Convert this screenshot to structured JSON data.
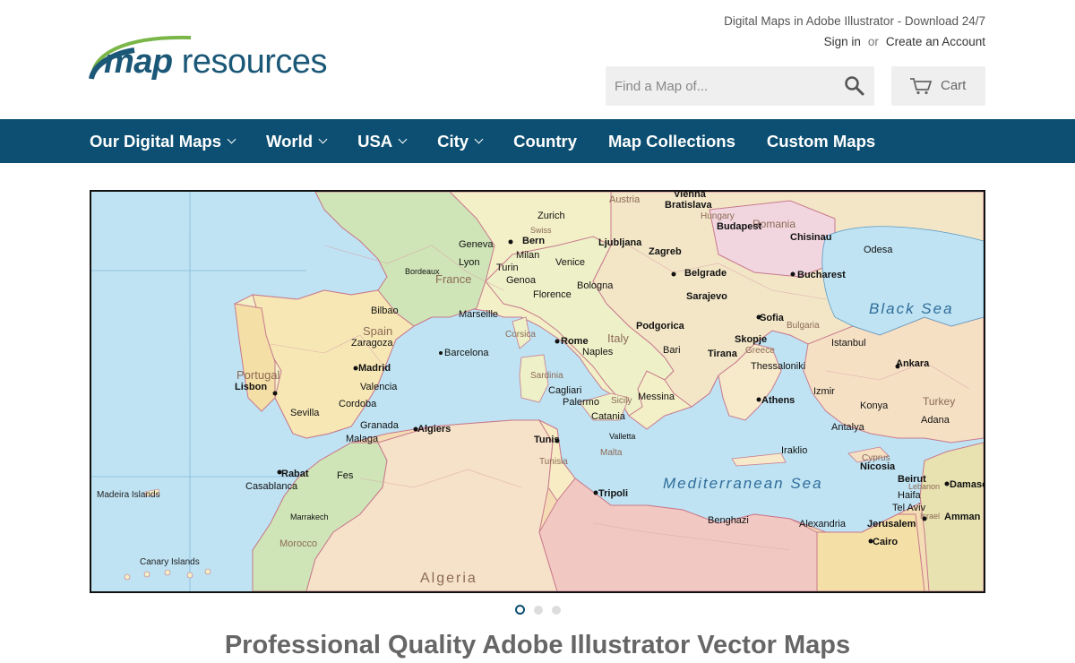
{
  "brand": {
    "logo_bold": "map",
    "logo_light": "resources"
  },
  "header": {
    "tagline": "Digital Maps in Adobe Illustrator - Download 24/7",
    "sign_in": "Sign in",
    "or": "or",
    "create_account": "Create an Account",
    "search_placeholder": "Find a Map of...",
    "cart_label": "Cart"
  },
  "nav": {
    "items": [
      {
        "label": "Our Digital Maps",
        "dropdown": true
      },
      {
        "label": "World",
        "dropdown": true
      },
      {
        "label": "USA",
        "dropdown": true
      },
      {
        "label": "City",
        "dropdown": true
      },
      {
        "label": "Country",
        "dropdown": false
      },
      {
        "label": "Map Collections",
        "dropdown": false
      },
      {
        "label": "Custom Maps",
        "dropdown": false
      }
    ]
  },
  "hero_map": {
    "seas": [
      "Black Sea",
      "Mediterranean Sea"
    ],
    "countries": [
      "France",
      "Spain",
      "Portugal",
      "Italy",
      "Sardinia",
      "Corsica",
      "Sicily",
      "Tunisia",
      "Algeria",
      "Morocco",
      "Romania",
      "Bulgaria",
      "Greece",
      "Turkey",
      "Malta",
      "Hungary",
      "Cyprus",
      "Lebanon",
      "Israel",
      "Austria",
      "Swiss"
    ],
    "cities": [
      "Lisbon",
      "Madrid",
      "Barcelona",
      "Valencia",
      "Sevilla",
      "Granada",
      "Malaga",
      "Cordoba",
      "Bilbao",
      "Zaragoza",
      "Marseille",
      "Lyon",
      "Bordeaux",
      "Geneva",
      "Bern",
      "Zurich",
      "Milan",
      "Turin",
      "Genoa",
      "Venice",
      "Florence",
      "Bologna",
      "Rome",
      "Naples",
      "Bari",
      "Palermo",
      "Cagliari",
      "Messina",
      "Catania",
      "Vienna",
      "Bratislava",
      "Budapest",
      "Zagreb",
      "Ljubljana",
      "Belgrade",
      "Sarajevo",
      "Podgorica",
      "Tirana",
      "Skopje",
      "Sofia",
      "Bucharest",
      "Chisinau",
      "Odesa",
      "Istanbul",
      "Ankara",
      "Izmir",
      "Athens",
      "Thessaloniki",
      "Algiers",
      "Tunis",
      "Tripoli",
      "Benghazi",
      "Rabat",
      "Casablanca",
      "Fes",
      "Marrakech",
      "Alexandria",
      "Cairo",
      "Beirut",
      "Damascus",
      "Nicosia",
      "Jerusalem",
      "Amman",
      "Tel Aviv",
      "Haifa",
      "Valletta",
      "Iraklio",
      "Adana",
      "Antalya",
      "Konya"
    ],
    "other_labels": [
      "Madeira Islands",
      "Canary Islands",
      "Mediterranean Sea",
      "Black Sea"
    ]
  },
  "carousel": {
    "slides": 3,
    "active": 1
  },
  "main": {
    "heading": "Professional Quality Adobe Illustrator Vector Maps"
  }
}
